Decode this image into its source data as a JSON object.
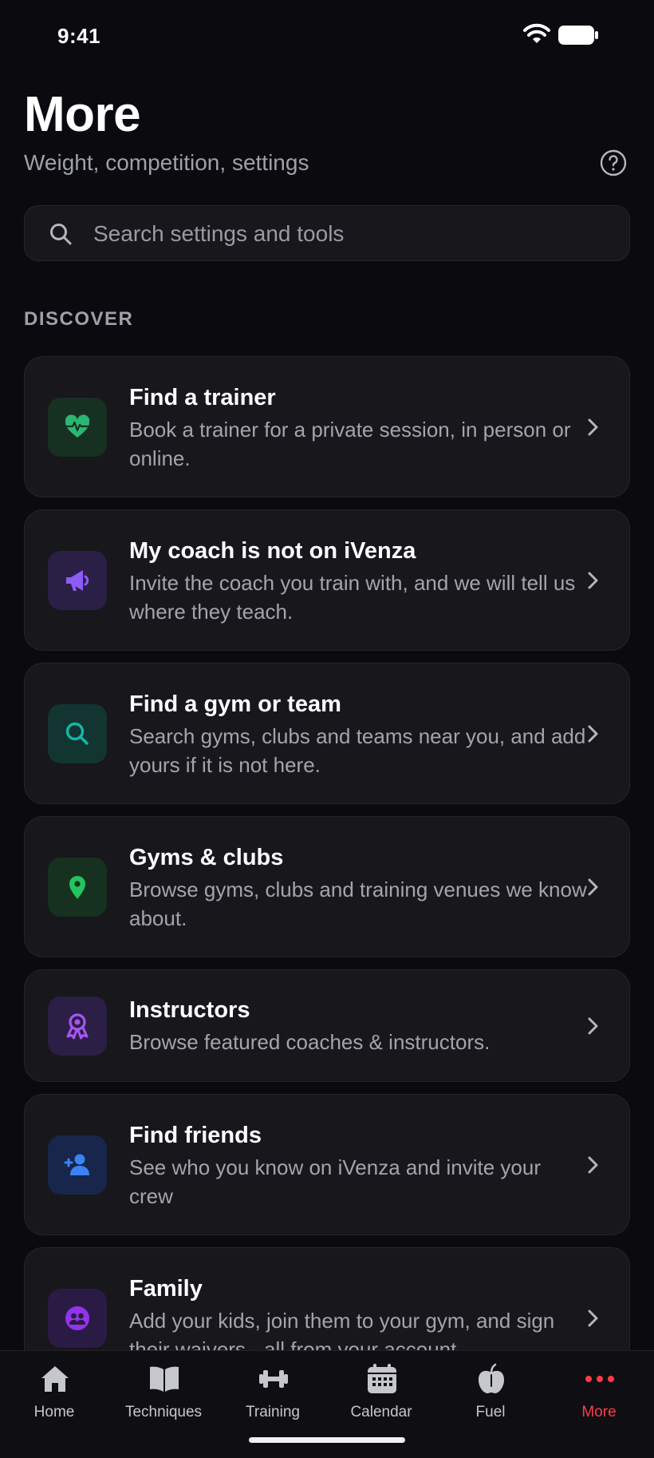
{
  "status_bar": {
    "time": "9:41"
  },
  "header": {
    "title": "More",
    "subtitle": "Weight, competition, settings",
    "help_icon": "help-circle-icon"
  },
  "search": {
    "placeholder": "Search settings and tools",
    "value": ""
  },
  "section": {
    "label": "DISCOVER"
  },
  "cards": [
    {
      "title": "Find a trainer",
      "description": "Book a trainer for a private session, in person or online.",
      "icon": "heart-pulse-icon",
      "accent": "#2bb673"
    },
    {
      "title": "My coach is not on iVenza",
      "description": "Invite the coach you train with, and we will tell us where they teach.",
      "icon": "megaphone-icon",
      "accent": "#8b5cf6"
    },
    {
      "title": "Find a gym or team",
      "description": "Search gyms, clubs and teams near you, and add yours if it is not here.",
      "icon": "search-icon",
      "accent": "#14b8a6"
    },
    {
      "title": "Gyms & clubs",
      "description": "Browse gyms, clubs and training venues we know about.",
      "icon": "map-pin-icon",
      "accent": "#22c55e"
    },
    {
      "title": "Instructors",
      "description": "Browse featured coaches & instructors.",
      "icon": "award-icon",
      "accent": "#a855f7"
    },
    {
      "title": "Find friends",
      "description": "See who you know on iVenza and invite your crew",
      "icon": "user-plus-icon",
      "accent": "#3b82f6"
    },
    {
      "title": "Family",
      "description": "Add your kids, join them to your gym, and sign their waivers - all from your account.",
      "icon": "family-icon",
      "accent": "#9333ea"
    }
  ],
  "tab_bar": {
    "tabs": [
      {
        "label": "Home",
        "icon": "home-icon"
      },
      {
        "label": "Techniques",
        "icon": "book-icon"
      },
      {
        "label": "Training",
        "icon": "dumbbell-icon"
      },
      {
        "label": "Calendar",
        "icon": "calendar-icon"
      },
      {
        "label": "Fuel",
        "icon": "apple-icon"
      },
      {
        "label": "More",
        "icon": "more-dots-icon"
      }
    ],
    "active": "More"
  },
  "colors": {
    "background": "#0b0b0f",
    "card": "#17171c",
    "active_tab": "#ff3b48",
    "muted_text": "#9fa1a8"
  }
}
